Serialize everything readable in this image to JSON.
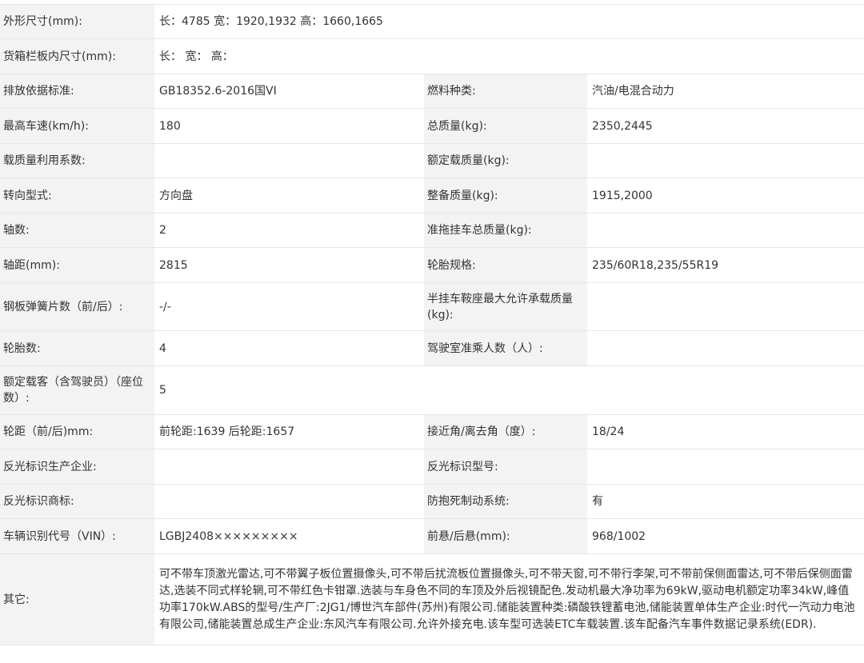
{
  "rows": {
    "dims": {
      "label": "外形尺寸(mm):",
      "value": "长：4785 宽：1920,1932 高：1660,1665"
    },
    "cargo": {
      "label": "货箱栏板内尺寸(mm):",
      "value": "长： 宽： 高："
    },
    "emission": {
      "label": "排放依据标准:",
      "value": "GB18352.6-2016国VI",
      "label2": "燃料种类:",
      "value2": "汽油/电混合动力"
    },
    "speed": {
      "label": "最高车速(km/h):",
      "value": "180",
      "label2": "总质量(kg):",
      "value2": "2350,2445"
    },
    "loadcoef": {
      "label": "载质量利用系数:",
      "value": "",
      "label2": "额定载质量(kg):",
      "value2": ""
    },
    "steering": {
      "label": "转向型式:",
      "value": "方向盘",
      "label2": "整备质量(kg):",
      "value2": "1915,2000"
    },
    "axles": {
      "label": "轴数:",
      "value": "2",
      "label2": "准拖挂车总质量(kg):",
      "value2": ""
    },
    "wheelbase": {
      "label": "轴距(mm):",
      "value": "2815",
      "label2": "轮胎规格:",
      "value2": "235/60R18,235/55R19"
    },
    "springs": {
      "label": "钢板弹簧片数（前/后）:",
      "value": "-/-",
      "label2": "半挂车鞍座最大允许承载质量(kg):",
      "value2": ""
    },
    "tires": {
      "label": "轮胎数:",
      "value": "4",
      "label2": "驾驶室准乘人数（人）:",
      "value2": ""
    },
    "seats": {
      "label": "额定载客（含驾驶员）（座位数）:",
      "value": "5"
    },
    "track": {
      "label": "轮距（前/后)mm:",
      "value": "前轮距:1639 后轮距:1657",
      "label2": "接近角/离去角（度）:",
      "value2": "18/24"
    },
    "reflector_maker": {
      "label": "反光标识生产企业:",
      "value": "",
      "label2": "反光标识型号:",
      "value2": ""
    },
    "reflector_brand": {
      "label": "反光标识商标:",
      "value": "",
      "label2": "防抱死制动系统:",
      "value2": "有"
    },
    "vin": {
      "label": "车辆识别代号（VIN）:",
      "value": "LGBJ2408×××××××××",
      "label2": "前悬/后悬(mm):",
      "value2": "968/1002"
    },
    "other": {
      "label": "其它:",
      "value": "可不带车顶激光雷达,可不带翼子板位置摄像头,可不带后扰流板位置摄像头,可不带天窗,可不带行李架,可不带前保侧面雷达,可不带后保侧面雷达,选装不同式样轮辋,可不带红色卡钳罩.选装与车身色不同的车顶及外后视镜配色.发动机最大净功率为69kW,驱动电机额定功率34kW,峰值功率170kW.ABS的型号/生产厂:2JG1/博世汽车部件(苏州)有限公司.储能装置种类:磷酸铁锂蓄电池,储能装置单体生产企业:时代一汽动力电池有限公司,储能装置总成生产企业:东风汽车有限公司.允许外接充电.该车型可选装ETC车载装置.该车配备汽车事件数据记录系统(EDR)."
    }
  }
}
